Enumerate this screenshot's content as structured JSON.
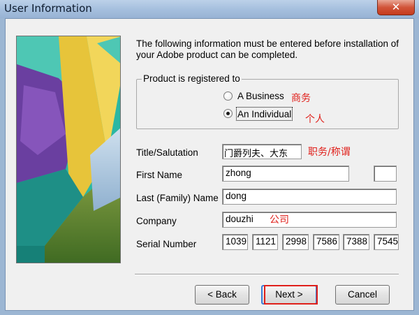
{
  "window": {
    "title": "User Information",
    "close_glyph": "✕"
  },
  "intro": {
    "line1": "The following information must be entered before installation of",
    "line2": "your Adobe product can be completed."
  },
  "registration": {
    "legend": "Product is registered to",
    "options": [
      {
        "label": "A Business",
        "selected": false,
        "annotation": "商务"
      },
      {
        "label": "An Individual",
        "selected": true,
        "annotation": "个人"
      }
    ]
  },
  "form": {
    "title_label": "Title/Salutation",
    "title_value": "门爵列夫、大东",
    "title_annotation": "职务/称谓",
    "first_name_label": "First Name",
    "first_name_value": "zhong",
    "middle_initial_value": "",
    "last_name_label": "Last (Family) Name",
    "last_name_value": "dong",
    "company_label": "Company",
    "company_value": "douzhi",
    "company_annotation": "公司",
    "serial_label": "Serial Number",
    "serial_parts": [
      "1039",
      "1121",
      "2998",
      "7586",
      "7388",
      "7545"
    ]
  },
  "buttons": {
    "back": "< Back",
    "next": "Next >",
    "cancel": "Cancel"
  },
  "icons": {
    "radio": "radio-button-icon",
    "close": "close-icon"
  },
  "colors": {
    "annotation_red": "#e0201b",
    "titlebar": "#a4bedd",
    "dialog_bg": "#f0f0f0"
  }
}
